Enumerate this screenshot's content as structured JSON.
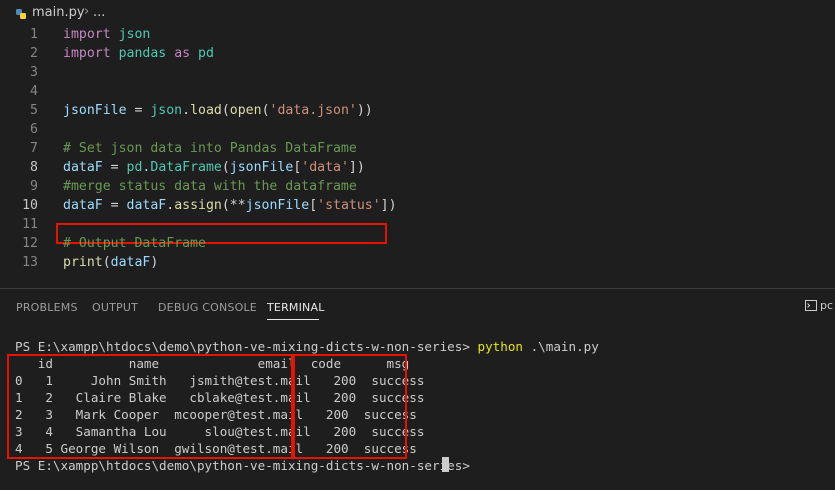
{
  "breadcrumb": {
    "file": "main.py",
    "separator": "›",
    "rest": "..."
  },
  "editor": {
    "lines": [
      {
        "n": "1",
        "tokens": [
          {
            "c": "kw",
            "t": "import"
          },
          {
            "c": "",
            "t": " "
          },
          {
            "c": "cls",
            "t": "json"
          }
        ]
      },
      {
        "n": "2",
        "tokens": [
          {
            "c": "kw",
            "t": "import"
          },
          {
            "c": "",
            "t": " "
          },
          {
            "c": "cls",
            "t": "pandas"
          },
          {
            "c": "",
            "t": " "
          },
          {
            "c": "kw",
            "t": "as"
          },
          {
            "c": "",
            "t": " "
          },
          {
            "c": "cls",
            "t": "pd"
          }
        ]
      },
      {
        "n": "3",
        "tokens": []
      },
      {
        "n": "4",
        "tokens": []
      },
      {
        "n": "5",
        "tokens": [
          {
            "c": "var",
            "t": "jsonFile"
          },
          {
            "c": "",
            "t": " = "
          },
          {
            "c": "cls",
            "t": "json"
          },
          {
            "c": "",
            "t": "."
          },
          {
            "c": "fn",
            "t": "load"
          },
          {
            "c": "",
            "t": "("
          },
          {
            "c": "fn",
            "t": "open"
          },
          {
            "c": "",
            "t": "("
          },
          {
            "c": "str",
            "t": "'data.json'"
          },
          {
            "c": "",
            "t": "))"
          }
        ]
      },
      {
        "n": "6",
        "tokens": []
      },
      {
        "n": "7",
        "tokens": [
          {
            "c": "com",
            "t": "# Set json data into Pandas DataFrame"
          }
        ]
      },
      {
        "n": "8",
        "tokens": [
          {
            "c": "var",
            "t": "dataF"
          },
          {
            "c": "",
            "t": " = "
          },
          {
            "c": "cls",
            "t": "pd"
          },
          {
            "c": "",
            "t": "."
          },
          {
            "c": "cls",
            "t": "DataFrame"
          },
          {
            "c": "",
            "t": "("
          },
          {
            "c": "var",
            "t": "jsonFile"
          },
          {
            "c": "",
            "t": "["
          },
          {
            "c": "str",
            "t": "'data'"
          },
          {
            "c": "",
            "t": "])"
          }
        ]
      },
      {
        "n": "9",
        "tokens": [
          {
            "c": "com",
            "t": "#merge status data with the dataframe"
          }
        ]
      },
      {
        "n": "10",
        "tokens": [
          {
            "c": "var",
            "t": "dataF"
          },
          {
            "c": "",
            "t": " = "
          },
          {
            "c": "var",
            "t": "dataF"
          },
          {
            "c": "",
            "t": "."
          },
          {
            "c": "fn",
            "t": "assign"
          },
          {
            "c": "",
            "t": "(**"
          },
          {
            "c": "var",
            "t": "jsonFile"
          },
          {
            "c": "",
            "t": "["
          },
          {
            "c": "str",
            "t": "'status'"
          },
          {
            "c": "",
            "t": "])"
          }
        ]
      },
      {
        "n": "11",
        "tokens": []
      },
      {
        "n": "12",
        "tokens": [
          {
            "c": "com",
            "t": "# Output DataFrame"
          }
        ]
      },
      {
        "n": "13",
        "tokens": [
          {
            "c": "fn",
            "t": "print"
          },
          {
            "c": "",
            "t": "("
          },
          {
            "c": "var",
            "t": "dataF"
          },
          {
            "c": "",
            "t": ")"
          }
        ]
      }
    ]
  },
  "panel": {
    "tabs": [
      "PROBLEMS",
      "OUTPUT",
      "DEBUG CONSOLE",
      "TERMINAL"
    ],
    "active_tab": "TERMINAL",
    "right_label": "pc"
  },
  "terminal": {
    "prompt": "PS E:\\xampp\\htdocs\\demo\\python-ve-mixing-dicts-w-non-series> ",
    "command": "python",
    "command_args": " .\\main.py",
    "table_lines": [
      "   id          name             email  code      msg",
      "0   1     John Smith   jsmith@test.mail   200  success",
      "1   2   Claire Blake   cblake@test.mail   200  success",
      "2   3   Mark Cooper  mcooper@test.mail   200  success",
      "3   4   Samantha Lou     slou@test.mail   200  success",
      "4   5 George Wilson  gwilson@test.mail   200  success"
    ],
    "final_prompt": "PS E:\\xampp\\htdocs\\demo\\python-ve-mixing-dicts-w-non-series>"
  },
  "colors": {
    "highlight_box": "#e51400",
    "background": "#1e1e1e"
  }
}
